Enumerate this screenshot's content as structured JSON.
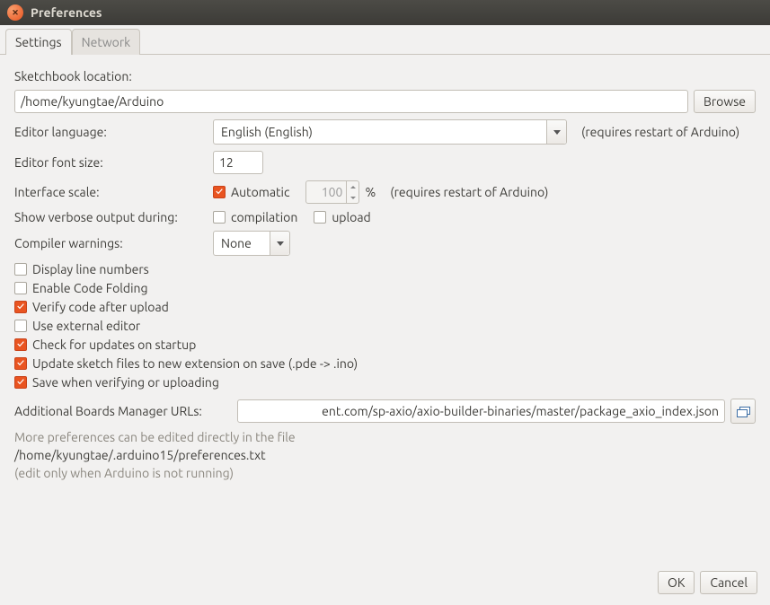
{
  "window": {
    "title": "Preferences"
  },
  "tabs": {
    "settings": "Settings",
    "network": "Network"
  },
  "sketchbook": {
    "label": "Sketchbook location:",
    "path": "/home/kyungtae/Arduino",
    "browse": "Browse"
  },
  "editorLanguage": {
    "label": "Editor language:",
    "value": "English (English)",
    "hint": "(requires restart of Arduino)"
  },
  "fontSize": {
    "label": "Editor font size:",
    "value": "12"
  },
  "interfaceScale": {
    "label": "Interface scale:",
    "automatic": "Automatic",
    "value": "100",
    "percent": "%",
    "hint": "(requires restart of Arduino)"
  },
  "verbose": {
    "label": "Show verbose output during:",
    "compilation": "compilation",
    "upload": "upload"
  },
  "compilerWarnings": {
    "label": "Compiler warnings:",
    "value": "None"
  },
  "opts": {
    "lineNumbers": "Display line numbers",
    "codeFolding": "Enable Code Folding",
    "verify": "Verify code after upload",
    "externalEditor": "Use external editor",
    "checkUpdates": "Check for updates on startup",
    "updateExt": "Update sketch files to new extension on save (.pde -> .ino)",
    "saveVerify": "Save when verifying or uploading"
  },
  "boardsUrls": {
    "label": "Additional Boards Manager URLs:",
    "value": "ent.com/sp-axio/axio-builder-binaries/master/package_axio_index.json"
  },
  "footerText": {
    "more": "More preferences can be edited directly in the file",
    "path": "/home/kyungtae/.arduino15/preferences.txt",
    "note": "(edit only when Arduino is not running)"
  },
  "buttons": {
    "ok": "OK",
    "cancel": "Cancel"
  }
}
